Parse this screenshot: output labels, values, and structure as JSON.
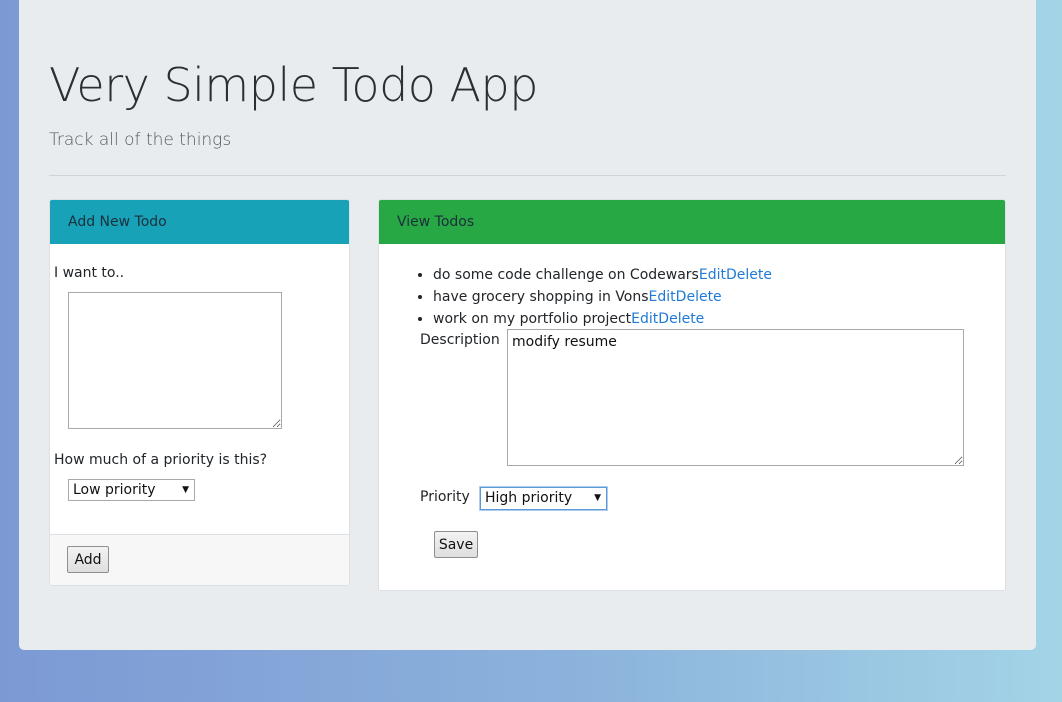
{
  "header": {
    "title": "Very Simple Todo App",
    "subtitle": "Track all of the things"
  },
  "add_card": {
    "header": "Add New Todo",
    "textarea_label": "I want to..",
    "textarea_value": "",
    "priority_label": "How much of a priority is this?",
    "priority_selected": "Low priority",
    "add_button": "Add"
  },
  "view_card": {
    "header": "View Todos",
    "todos": [
      {
        "text": "do some code challenge on Codewars",
        "edit": "Edit",
        "delete": "Delete"
      },
      {
        "text": "have grocery shopping in Vons",
        "edit": "Edit",
        "delete": "Delete"
      },
      {
        "text": "work on my portfolio project",
        "edit": "Edit",
        "delete": "Delete"
      }
    ],
    "edit_form": {
      "description_label": "Description",
      "description_value": "modify resume",
      "priority_label": "Priority",
      "priority_selected": "High priority",
      "save_button": "Save"
    }
  },
  "colors": {
    "add_header": "#17a2b8",
    "view_header": "#28a745",
    "link": "#1f7ad6",
    "jumbotron": "#e9ecef"
  }
}
